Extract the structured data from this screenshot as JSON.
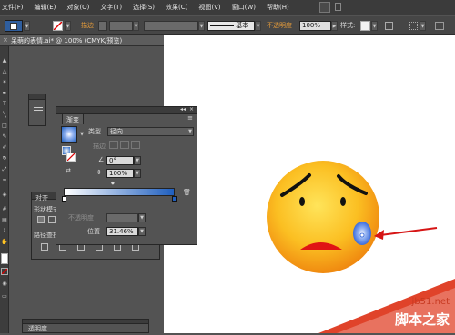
{
  "menubar": {
    "items": [
      "文件(F)",
      "编辑(E)",
      "对象(O)",
      "文字(T)",
      "选择(S)",
      "效果(C)",
      "视图(V)",
      "窗口(W)",
      "帮助(H)"
    ]
  },
  "control_bar": {
    "stroke_label": "描边",
    "stroke_style_label": "基本",
    "opacity_label": "不透明度",
    "opacity_value": "100%",
    "style_label": "样式:"
  },
  "document": {
    "tab_title": "呆萌的表情.ai* @ 100% (CMYK/预览)",
    "close_glyph": "×"
  },
  "gradient_panel": {
    "tab_label": "渐变",
    "type_label": "类型",
    "type_value": "径向",
    "stroke_label": "描边",
    "angle_value": "0°",
    "aspect_value": "100%",
    "opacity_label": "不透明度",
    "location_label": "位置",
    "location_value": "31.46%"
  },
  "align_panel": {
    "tab_label": "对齐",
    "shape_mode_label": "形状模式:",
    "pathfinder_label": "路径查找器"
  },
  "transparency_panel": {
    "tab_label": "透明度"
  },
  "watermark": {
    "site": "jb51.net",
    "brand": "脚本之家"
  },
  "colors": {
    "face_gradient_inner": "#ffe45a",
    "face_gradient_outer": "#f08a10",
    "tear_blue": "#2a5fd8",
    "arrow_red": "#d61515",
    "mouth_red": "#e01414",
    "gradient_bar_start": "#ffffff",
    "gradient_bar_end": "#1f5fbf"
  }
}
